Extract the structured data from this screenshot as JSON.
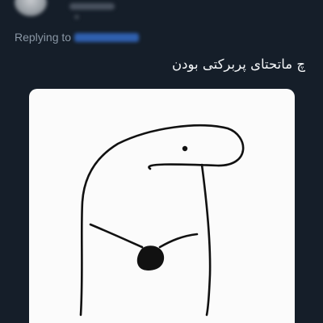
{
  "reply": {
    "label": "Replying to"
  },
  "tweet": {
    "text": "چ ماتحتای پربرکتی بودن"
  },
  "colors": {
    "background": "#151e29",
    "secondary_text": "#8a97a5",
    "primary_text": "#f3f5f7",
    "link": "#2f5fae",
    "media_background": "#fbfbfb"
  },
  "icons": {
    "avatar": "blurred-avatar",
    "media": "flork-meme-drawing"
  }
}
